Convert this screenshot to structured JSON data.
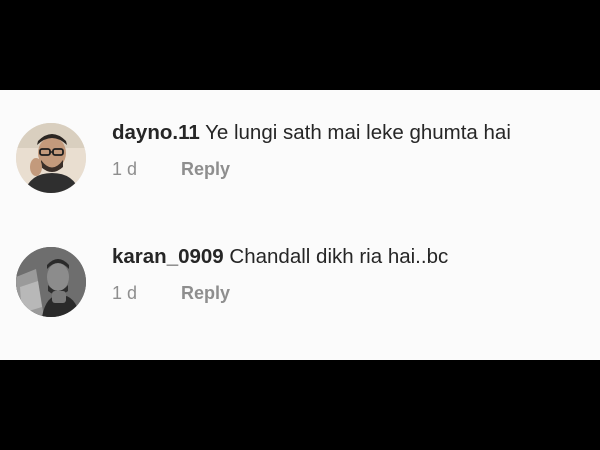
{
  "comments": [
    {
      "username": "dayno.11",
      "text": "Ye lungi sath mai leke ghumta hai",
      "time": "1 d",
      "reply_label": "Reply"
    },
    {
      "username": "karan_0909",
      "text": "Chandall dikh ria hai..bc",
      "time": "1 d",
      "reply_label": "Reply"
    }
  ]
}
